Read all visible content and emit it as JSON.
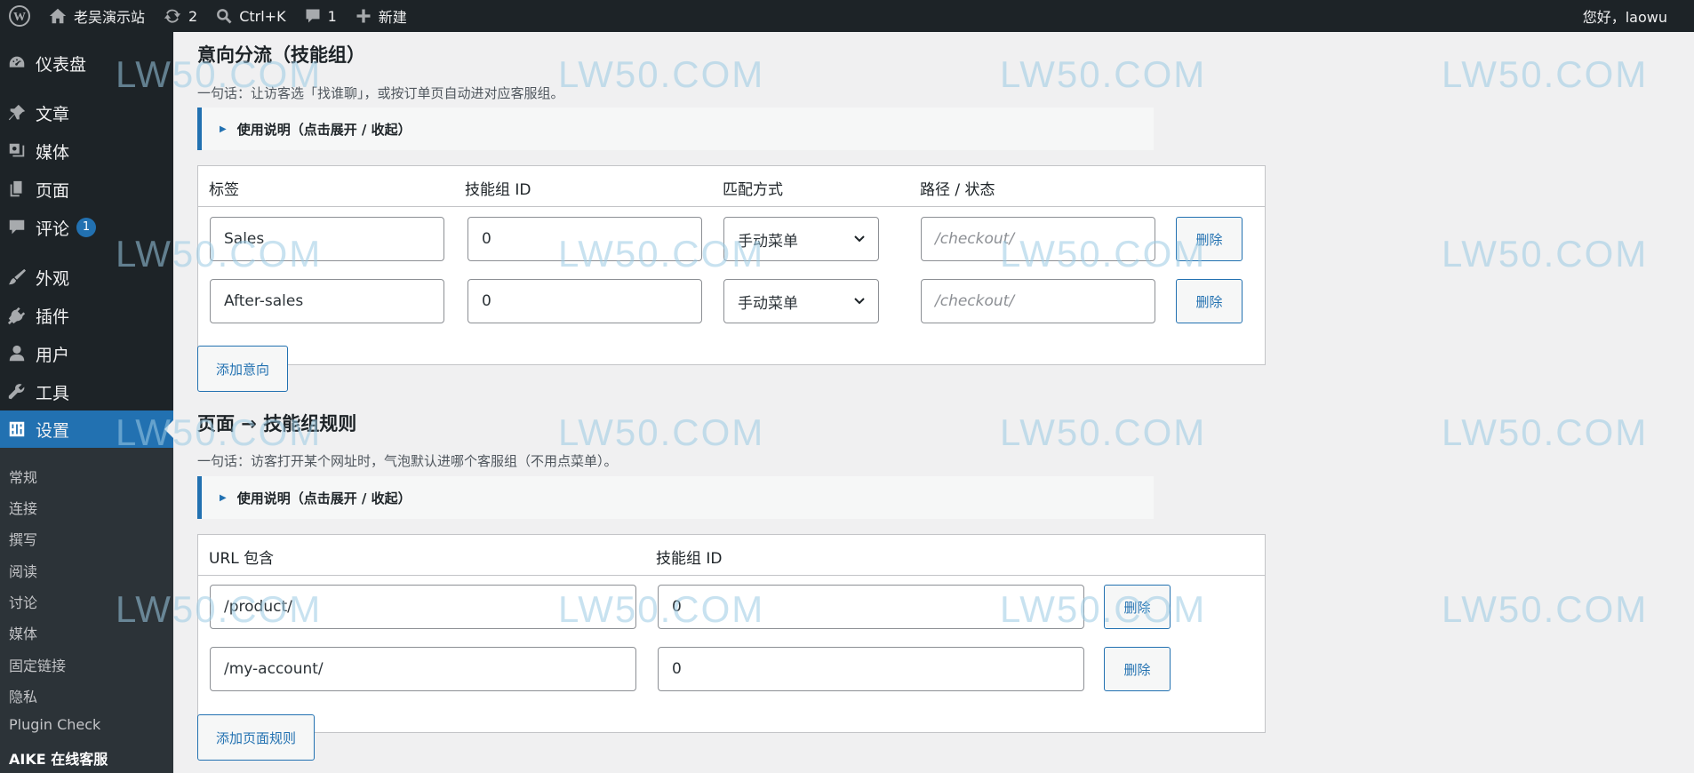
{
  "adminbar": {
    "site_name": "老吴演示站",
    "updates_count": "2",
    "search_shortcut": "Ctrl+K",
    "comments_count": "1",
    "new_label": "新建",
    "greeting": "您好，laowu"
  },
  "sidebar": {
    "items": [
      {
        "label": "仪表盘",
        "icon": "dashboard-icon"
      },
      {
        "label": "文章",
        "icon": "pin-icon"
      },
      {
        "label": "媒体",
        "icon": "media-icon"
      },
      {
        "label": "页面",
        "icon": "page-icon"
      },
      {
        "label": "评论",
        "icon": "comment-icon",
        "badge": "1"
      },
      {
        "label": "外观",
        "icon": "brush-icon"
      },
      {
        "label": "插件",
        "icon": "plugin-icon"
      },
      {
        "label": "用户",
        "icon": "user-icon"
      },
      {
        "label": "工具",
        "icon": "wrench-icon"
      },
      {
        "label": "设置",
        "icon": "settings-icon",
        "active": true
      }
    ],
    "submenu": [
      "常规",
      "连接",
      "撰写",
      "阅读",
      "讨论",
      "媒体",
      "固定链接",
      "隐私",
      "Plugin Check",
      "AIKE 在线客服"
    ]
  },
  "intent": {
    "title": "意向分流（技能组）",
    "desc": "一句话：让访客选「找谁聊」，或按订单页自动进对应客服组。",
    "details_label": "使用说明（点击展开 / 收起）",
    "headers": [
      "标签",
      "技能组 ID",
      "匹配方式",
      "路径 / 状态"
    ],
    "rows": [
      {
        "label": "Sales",
        "group_id": "0",
        "match": "手动菜单",
        "path_placeholder": "/checkout/"
      },
      {
        "label": "After-sales",
        "group_id": "0",
        "match": "手动菜单",
        "path_placeholder": "/checkout/"
      }
    ],
    "delete_label": "删除",
    "add_label": "添加意向"
  },
  "page_rules": {
    "title": "页面 → 技能组规则",
    "desc": "一句话：访客打开某个网址时，气泡默认进哪个客服组（不用点菜单）。",
    "details_label": "使用说明（点击展开 / 收起）",
    "headers": [
      "URL 包含",
      "技能组 ID"
    ],
    "rows": [
      {
        "url": "/product/",
        "group_id": "0"
      },
      {
        "url": "/my-account/",
        "group_id": "0"
      }
    ],
    "delete_label": "删除",
    "add_label": "添加页面规则"
  },
  "watermark": "LW50.COM",
  "colors": {
    "accent": "#2271b1",
    "adminbar_bg": "#1d2327",
    "watermark": "#9ccbe4"
  }
}
